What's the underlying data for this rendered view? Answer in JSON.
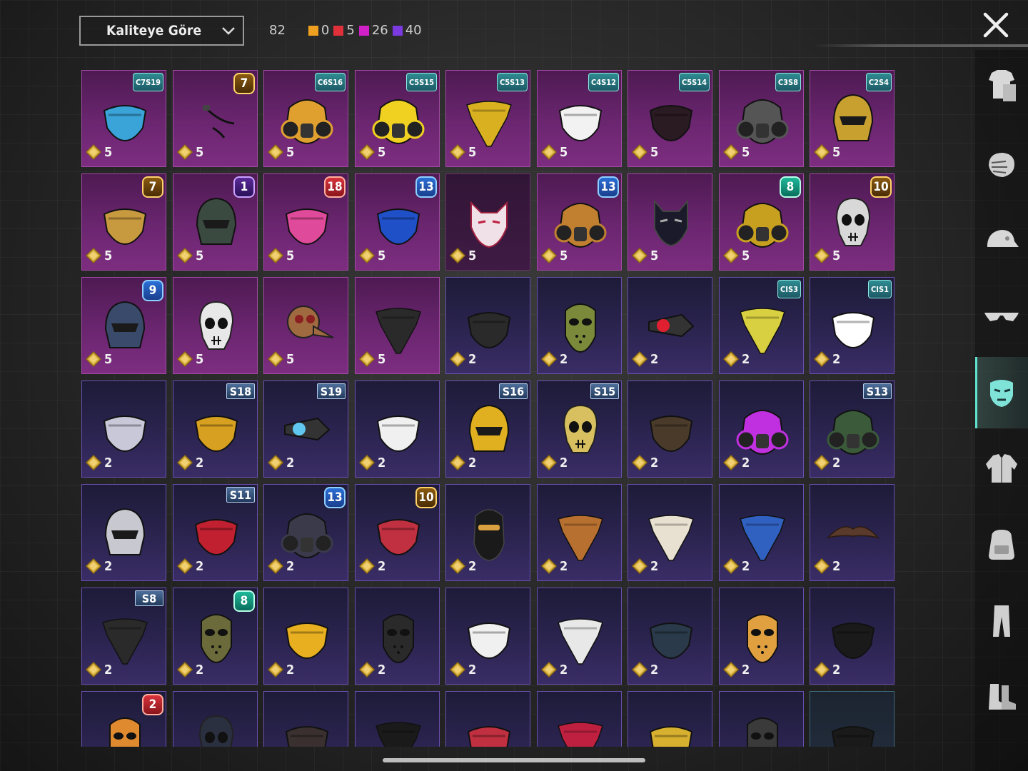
{
  "sort": {
    "label": "Kaliteye Göre",
    "icon": "chevron-down-icon"
  },
  "counts": {
    "total": "82",
    "groups": [
      {
        "color": "#f0a020",
        "value": "0"
      },
      {
        "color": "#e0303a",
        "value": "5"
      },
      {
        "color": "#d020c8",
        "value": "26"
      },
      {
        "color": "#7a3ae0",
        "value": "40"
      }
    ]
  },
  "close": {
    "icon": "close-icon"
  },
  "sidebar": {
    "tabs": [
      {
        "name": "outfit-tab",
        "icon": "outfit-icon",
        "active": false
      },
      {
        "name": "face-tab",
        "icon": "face-icon",
        "active": false
      },
      {
        "name": "hat-tab",
        "icon": "cap-icon",
        "active": false
      },
      {
        "name": "eyewear-tab",
        "icon": "glasses-icon",
        "active": false
      },
      {
        "name": "mask-tab",
        "icon": "mask-icon",
        "active": true
      },
      {
        "name": "jacket-tab",
        "icon": "jacket-icon",
        "active": false
      },
      {
        "name": "backpack-tab",
        "icon": "backpack-icon",
        "active": false
      },
      {
        "name": "pants-tab",
        "icon": "pants-icon",
        "active": false
      },
      {
        "name": "shoes-tab",
        "icon": "shoes-icon",
        "active": false
      }
    ]
  },
  "items": [
    {
      "rarity": "epic",
      "badge": "C7S19",
      "badge_type": "tag",
      "cost": "5",
      "icon": "mask-icon",
      "color": "#3aa3d8"
    },
    {
      "rarity": "epic",
      "badge": "7",
      "badge_type": "hex",
      "badge_color": "gold",
      "cost": "5",
      "icon": "earpiece-icon",
      "color": "#222222"
    },
    {
      "rarity": "epic",
      "badge": "C6S16",
      "badge_type": "tag",
      "cost": "5",
      "icon": "gasmask-icon",
      "color": "#e0a030"
    },
    {
      "rarity": "epic",
      "badge": "C5S15",
      "badge_type": "tag",
      "cost": "5",
      "icon": "gasmask-icon",
      "color": "#f0d020"
    },
    {
      "rarity": "epic",
      "badge": "C5S13",
      "badge_type": "tag",
      "cost": "5",
      "icon": "bandana-icon",
      "color": "#d8b020"
    },
    {
      "rarity": "epic",
      "badge": "C4S12",
      "badge_type": "tag",
      "cost": "5",
      "icon": "mask-icon",
      "color": "#f2f2f2"
    },
    {
      "rarity": "epic",
      "badge": "C5S14",
      "badge_type": "tag",
      "cost": "5",
      "icon": "mask-icon",
      "color": "#2a1a22"
    },
    {
      "rarity": "epic",
      "badge": "C3S8",
      "badge_type": "tag",
      "cost": "5",
      "icon": "gasmask-icon",
      "color": "#555555"
    },
    {
      "rarity": "epic",
      "badge": "C2S4",
      "badge_type": "tag",
      "cost": "5",
      "icon": "helmet-icon",
      "color": "#c8a030"
    },
    {
      "rarity": "epic",
      "badge": "7",
      "badge_type": "hex",
      "badge_color": "gold",
      "cost": "5",
      "icon": "mask-icon",
      "color": "#c89a40"
    },
    {
      "rarity": "epic",
      "badge": "1",
      "badge_type": "hex",
      "badge_color": "purple",
      "cost": "5",
      "icon": "helmet-icon",
      "color": "#3a4a40"
    },
    {
      "rarity": "epic",
      "badge": "18",
      "badge_type": "hex",
      "badge_color": "red",
      "cost": "5",
      "icon": "mask-icon",
      "color": "#e04a9a"
    },
    {
      "rarity": "epic",
      "badge": "13",
      "badge_type": "hex",
      "badge_color": "blue",
      "cost": "5",
      "icon": "mask-icon",
      "color": "#2050c8"
    },
    {
      "rarity": "dim",
      "badge": "",
      "badge_type": "none",
      "cost": "5",
      "icon": "fox-mask-icon",
      "color": "#f0e0e8"
    },
    {
      "rarity": "epic",
      "badge": "13",
      "badge_type": "hex",
      "badge_color": "blue",
      "cost": "5",
      "icon": "gasmask-icon",
      "color": "#c08030"
    },
    {
      "rarity": "epic",
      "badge": "",
      "badge_type": "none",
      "cost": "5",
      "icon": "cat-mask-icon",
      "color": "#1a1a2a"
    },
    {
      "rarity": "epic",
      "badge": "8",
      "badge_type": "hex",
      "badge_color": "green",
      "cost": "5",
      "icon": "gasmask-icon",
      "color": "#c8a020"
    },
    {
      "rarity": "epic",
      "badge": "10",
      "badge_type": "hex",
      "badge_color": "gold",
      "cost": "5",
      "icon": "skull-mask-icon",
      "color": "#d8d8d8"
    },
    {
      "rarity": "epic",
      "badge": "9",
      "badge_type": "hex",
      "badge_color": "blue",
      "cost": "5",
      "icon": "helmet-icon",
      "color": "#3a4a6a"
    },
    {
      "rarity": "epic",
      "badge": "",
      "badge_type": "none",
      "cost": "5",
      "icon": "skull-mask-icon",
      "color": "#e8e8e8"
    },
    {
      "rarity": "epic",
      "badge": "",
      "badge_type": "none",
      "cost": "5",
      "icon": "plague-mask-icon",
      "color": "#a06a40"
    },
    {
      "rarity": "epic",
      "badge": "",
      "badge_type": "none",
      "cost": "5",
      "icon": "bandana-icon",
      "color": "#2a2a2a"
    },
    {
      "rarity": "rare",
      "badge": "",
      "badge_type": "none",
      "cost": "2",
      "icon": "mask-icon",
      "color": "#2a2a2a"
    },
    {
      "rarity": "rare",
      "badge": "",
      "badge_type": "none",
      "cost": "2",
      "icon": "hockey-mask-icon",
      "color": "#7a8a3a"
    },
    {
      "rarity": "rare",
      "badge": "",
      "badge_type": "none",
      "cost": "2",
      "icon": "visor-icon",
      "color": "#e02030"
    },
    {
      "rarity": "rare",
      "badge": "CIS3",
      "badge_type": "tag",
      "cost": "2",
      "icon": "bandana-icon",
      "color": "#d8d040"
    },
    {
      "rarity": "rare",
      "badge": "CIS1",
      "badge_type": "tag",
      "cost": "2",
      "icon": "mask-icon",
      "color": "#ffffff"
    },
    {
      "rarity": "rare",
      "badge": "",
      "badge_type": "none",
      "cost": "2",
      "icon": "mask-icon",
      "color": "#c8c8d8"
    },
    {
      "rarity": "rare",
      "badge": "S18",
      "badge_type": "season",
      "cost": "2",
      "icon": "mask-icon",
      "color": "#d8a020"
    },
    {
      "rarity": "rare",
      "badge": "S19",
      "badge_type": "season",
      "cost": "2",
      "icon": "visor-icon",
      "color": "#60c8f0"
    },
    {
      "rarity": "rare",
      "badge": "",
      "badge_type": "none",
      "cost": "2",
      "icon": "mask-icon",
      "color": "#f0f0f0"
    },
    {
      "rarity": "rare",
      "badge": "S16",
      "badge_type": "season",
      "cost": "2",
      "icon": "helmet-icon",
      "color": "#e0b020"
    },
    {
      "rarity": "rare",
      "badge": "S15",
      "badge_type": "season",
      "cost": "2",
      "icon": "skull-mask-icon",
      "color": "#d8c060"
    },
    {
      "rarity": "rare",
      "badge": "",
      "badge_type": "none",
      "cost": "2",
      "icon": "mask-icon",
      "color": "#4a3a2a"
    },
    {
      "rarity": "rare",
      "badge": "",
      "badge_type": "none",
      "cost": "2",
      "icon": "gasmask-icon",
      "color": "#c030e0"
    },
    {
      "rarity": "rare",
      "badge": "S13",
      "badge_type": "season",
      "cost": "2",
      "icon": "gasmask-icon",
      "color": "#3a5a3a"
    },
    {
      "rarity": "rare",
      "badge": "",
      "badge_type": "none",
      "cost": "2",
      "icon": "helmet-icon",
      "color": "#c8c8d0"
    },
    {
      "rarity": "rare",
      "badge": "S11",
      "badge_type": "season",
      "cost": "2",
      "icon": "mask-icon",
      "color": "#c02030"
    },
    {
      "rarity": "rare",
      "badge": "13",
      "badge_type": "hex",
      "badge_color": "blue",
      "cost": "2",
      "icon": "gasmask-icon",
      "color": "#3a3a4a"
    },
    {
      "rarity": "rare",
      "badge": "10",
      "badge_type": "hex",
      "badge_color": "gold",
      "cost": "2",
      "icon": "mask-icon",
      "color": "#c03040"
    },
    {
      "rarity": "rare",
      "badge": "",
      "badge_type": "none",
      "cost": "2",
      "icon": "balaclava-icon",
      "color": "#1a1a1a"
    },
    {
      "rarity": "rare",
      "badge": "",
      "badge_type": "none",
      "cost": "2",
      "icon": "bandana-icon",
      "color": "#b87030"
    },
    {
      "rarity": "rare",
      "badge": "",
      "badge_type": "none",
      "cost": "2",
      "icon": "bandana-icon",
      "color": "#e8e0d0"
    },
    {
      "rarity": "rare",
      "badge": "",
      "badge_type": "none",
      "cost": "2",
      "icon": "bandana-icon",
      "color": "#3060c0"
    },
    {
      "rarity": "rare",
      "badge": "",
      "badge_type": "none",
      "cost": "2",
      "icon": "mustache-icon",
      "color": "#5a3a2a"
    },
    {
      "rarity": "rare",
      "badge": "S8",
      "badge_type": "season",
      "cost": "2",
      "icon": "bandana-icon",
      "color": "#2a2a2a"
    },
    {
      "rarity": "rare",
      "badge": "8",
      "badge_type": "hex",
      "badge_color": "green",
      "cost": "2",
      "icon": "hockey-mask-icon",
      "color": "#6a6a3a"
    },
    {
      "rarity": "rare",
      "badge": "",
      "badge_type": "none",
      "cost": "2",
      "icon": "mask-icon",
      "color": "#e8b020"
    },
    {
      "rarity": "rare",
      "badge": "",
      "badge_type": "none",
      "cost": "2",
      "icon": "hockey-mask-icon",
      "color": "#2a2a2a"
    },
    {
      "rarity": "rare",
      "badge": "",
      "badge_type": "none",
      "cost": "2",
      "icon": "mask-icon",
      "color": "#f0f0f0"
    },
    {
      "rarity": "rare",
      "badge": "",
      "badge_type": "none",
      "cost": "2",
      "icon": "bandana-icon",
      "color": "#e8e8e8"
    },
    {
      "rarity": "rare",
      "badge": "",
      "badge_type": "none",
      "cost": "2",
      "icon": "mask-icon",
      "color": "#2a3a4a"
    },
    {
      "rarity": "rare",
      "badge": "",
      "badge_type": "none",
      "cost": "2",
      "icon": "hockey-mask-icon",
      "color": "#e0a040"
    },
    {
      "rarity": "rare",
      "badge": "",
      "badge_type": "none",
      "cost": "2",
      "icon": "mask-icon",
      "color": "#1a1a1a"
    },
    {
      "rarity": "rare",
      "badge": "2",
      "badge_type": "hex",
      "badge_color": "red",
      "cost": "",
      "icon": "hockey-mask-icon",
      "color": "#e08a30"
    },
    {
      "rarity": "rare",
      "badge": "",
      "badge_type": "none",
      "cost": "",
      "icon": "skull-mask-icon",
      "color": "#2a3040"
    },
    {
      "rarity": "rare",
      "badge": "",
      "badge_type": "none",
      "cost": "",
      "icon": "mask-icon",
      "color": "#3a3030"
    },
    {
      "rarity": "rare",
      "badge": "",
      "badge_type": "none",
      "cost": "",
      "icon": "bandana-icon",
      "color": "#1a1a1a"
    },
    {
      "rarity": "rare",
      "badge": "",
      "badge_type": "none",
      "cost": "",
      "icon": "mask-icon",
      "color": "#c03040"
    },
    {
      "rarity": "rare",
      "badge": "",
      "badge_type": "none",
      "cost": "",
      "icon": "bandana-icon",
      "color": "#c02040"
    },
    {
      "rarity": "rare",
      "badge": "",
      "badge_type": "none",
      "cost": "",
      "icon": "mask-icon",
      "color": "#d8b030"
    },
    {
      "rarity": "rare",
      "badge": "",
      "badge_type": "none",
      "cost": "",
      "icon": "hockey-mask-icon",
      "color": "#3a3a3a"
    },
    {
      "rarity": "blank",
      "badge": "",
      "badge_type": "none",
      "cost": "",
      "icon": "mask-icon",
      "color": "#1a1a1a"
    }
  ]
}
